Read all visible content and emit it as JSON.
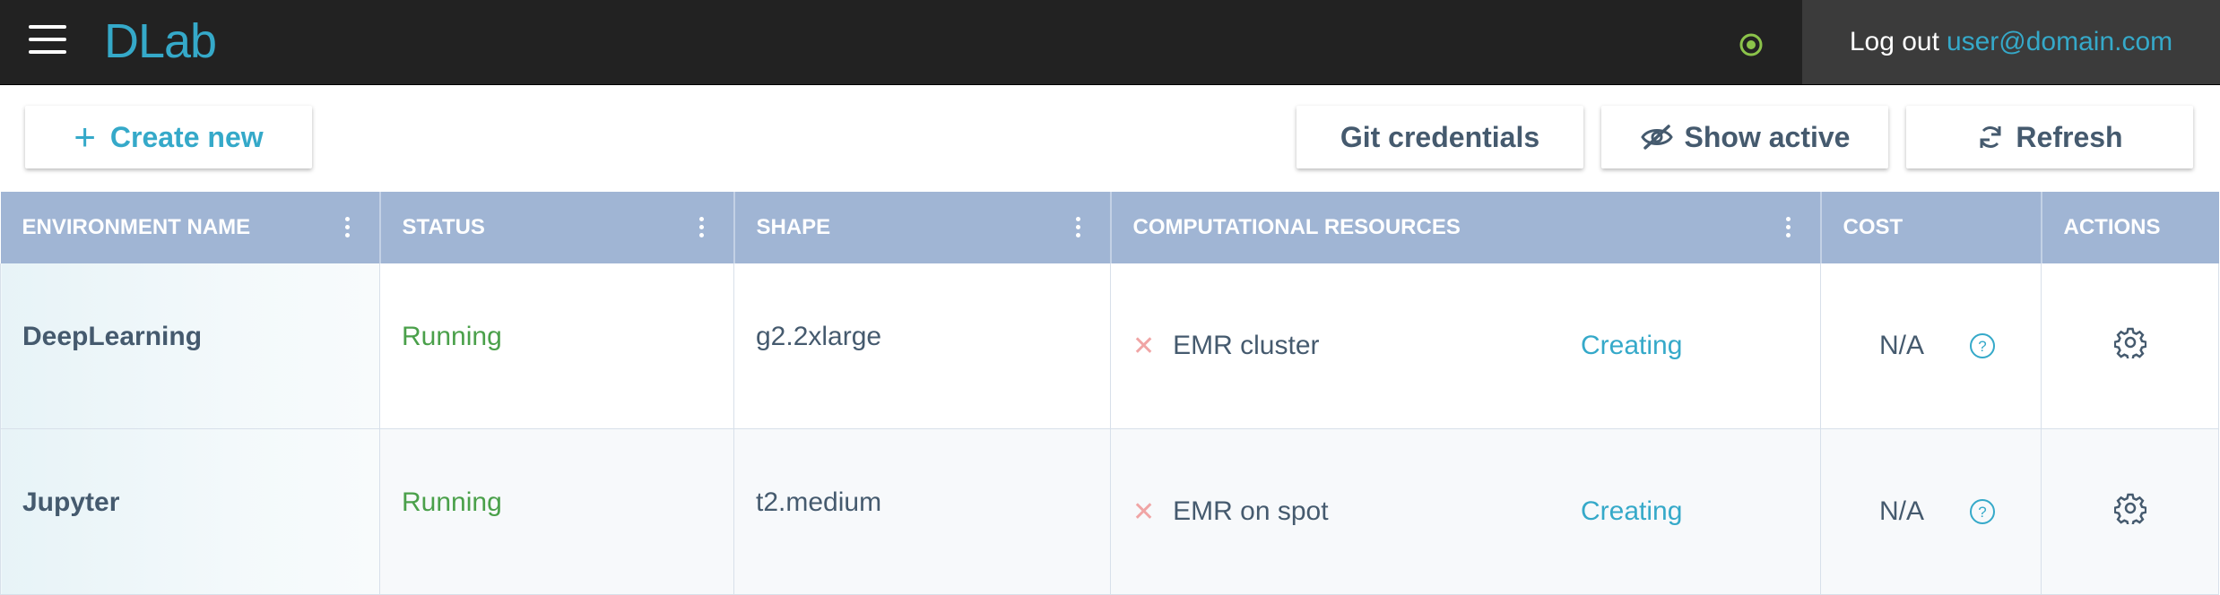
{
  "header": {
    "logo": "DLab",
    "logout_label": "Log out",
    "user_email": "user@domain.com",
    "status_color": "#8bc34a"
  },
  "toolbar": {
    "create_label": "Create new",
    "git_label": "Git credentials",
    "show_active_label": "Show active",
    "refresh_label": "Refresh"
  },
  "table": {
    "columns": [
      "ENVIRONMENT NAME",
      "STATUS",
      "SHAPE",
      "COMPUTATIONAL RESOURCES",
      "COST",
      "ACTIONS"
    ],
    "rows": [
      {
        "name": "DeepLearning",
        "status": "Running",
        "shape": "g2.2xlarge",
        "resource": "EMR cluster",
        "resource_status": "Creating",
        "cost": "N/A"
      },
      {
        "name": "Jupyter",
        "status": "Running",
        "shape": "t2.medium",
        "resource": "EMR on spot",
        "resource_status": "Creating",
        "cost": "N/A"
      }
    ]
  },
  "colors": {
    "accent": "#35a9c9",
    "running": "#4aa04a",
    "header_bg": "#a0b5d4",
    "topbar_bg": "#222222"
  }
}
